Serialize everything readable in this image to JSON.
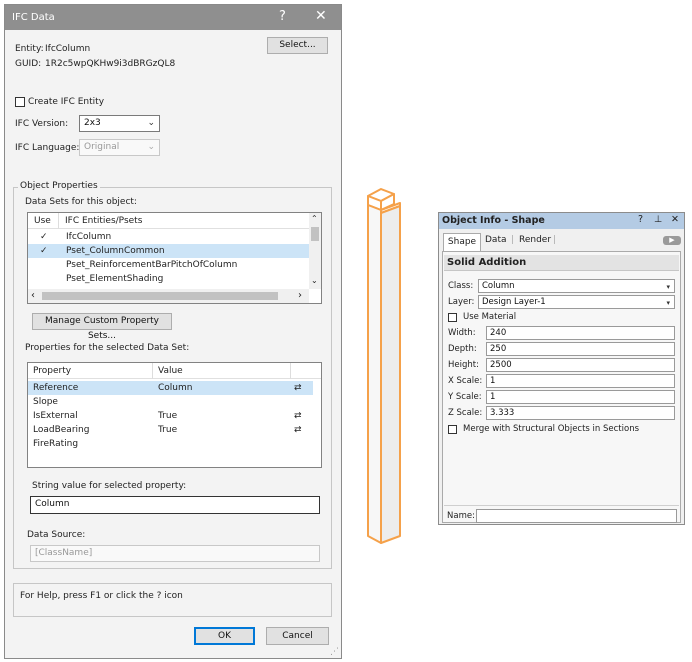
{
  "dialog": {
    "title": "IFC Data",
    "help_glyph": "?",
    "close_glyph": "✕",
    "entity_label": "Entity:",
    "entity_value": "IfcColumn",
    "guid_label": "GUID:",
    "guid_value": "1R2c5wpQKHw9i3dBRGzQL8",
    "select_button": "Select...",
    "create_entity_label": "Create IFC Entity",
    "create_entity_checked": false,
    "version_label": "IFC Version:",
    "version_value": "2x3",
    "language_label": "IFC Language:",
    "language_value": "Original",
    "object_properties_legend": "Object Properties",
    "data_sets_label": "Data Sets for this object:",
    "data_sets_columns": {
      "use": "Use",
      "entities": "IFC Entities/Psets"
    },
    "data_sets": [
      {
        "check": "✓",
        "name": "IfcColumn",
        "selected": false
      },
      {
        "check": "✓",
        "name": "Pset_ColumnCommon",
        "selected": true
      },
      {
        "check": "",
        "name": "Pset_ReinforcementBarPitchOfColumn",
        "selected": false
      },
      {
        "check": "",
        "name": "Pset_ElementShading",
        "selected": false
      }
    ],
    "manage_button": "Manage Custom Property Sets...",
    "properties_label": "Properties for the selected Data Set:",
    "properties_columns": {
      "property": "Property",
      "value": "Value"
    },
    "properties": [
      {
        "name": "Reference",
        "value": "Column",
        "icon": "⇄",
        "selected": true
      },
      {
        "name": "Slope",
        "value": "",
        "icon": "",
        "selected": false
      },
      {
        "name": "IsExternal",
        "value": "True",
        "icon": "⇄",
        "selected": false
      },
      {
        "name": "LoadBearing",
        "value": "True",
        "icon": "⇄",
        "selected": false
      },
      {
        "name": "FireRating",
        "value": "",
        "icon": "",
        "selected": false
      }
    ],
    "string_value_label": "String value for selected property:",
    "string_value": "Column",
    "data_source_label": "Data Source:",
    "data_source_value": "[ClassName]",
    "help_text": "For Help, press F1 or click the ? icon",
    "ok_button": "OK",
    "cancel_button": "Cancel"
  },
  "palette": {
    "title": "Object Info - Shape",
    "tabs": [
      "Shape",
      "Data",
      "Render"
    ],
    "header": "Solid Addition",
    "class_label": "Class:",
    "class_value": "Column",
    "layer_label": "Layer:",
    "layer_value": "Design Layer-1",
    "use_material_label": "Use Material",
    "fields": [
      {
        "label": "Width:",
        "value": "240"
      },
      {
        "label": "Depth:",
        "value": "250"
      },
      {
        "label": "Height:",
        "value": "2500"
      },
      {
        "label": "X Scale:",
        "value": "1"
      },
      {
        "label": "Y Scale:",
        "value": "1"
      },
      {
        "label": "Z Scale:",
        "value": "3.333"
      }
    ],
    "merge_label": "Merge with Structural Objects in Sections",
    "name_label": "Name:",
    "name_value": ""
  },
  "colors": {
    "titlebar": "#8f8f8f",
    "selection": "#cce4f7",
    "ok_border": "#0078d7",
    "palette_titlebar": "#b4cbe4",
    "column_highlight": "#f5a14a"
  }
}
